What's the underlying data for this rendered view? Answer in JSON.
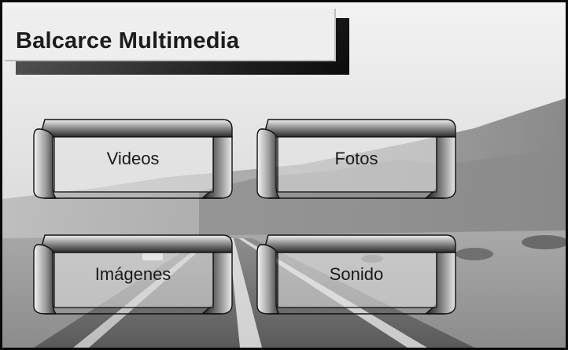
{
  "app": {
    "title": "Balcarce Multimedia"
  },
  "menu": {
    "items": [
      {
        "id": "videos",
        "label": "Videos"
      },
      {
        "id": "fotos",
        "label": "Fotos"
      },
      {
        "id": "imagenes",
        "label": "Imágenes"
      },
      {
        "id": "sonido",
        "label": "Sonido"
      }
    ]
  },
  "background": {
    "description_free": true,
    "colors": {
      "sky": "#e4e4e4",
      "hills": "#8f8f8f",
      "road": "#6e6e6e",
      "line": "#f2f2f2"
    }
  }
}
